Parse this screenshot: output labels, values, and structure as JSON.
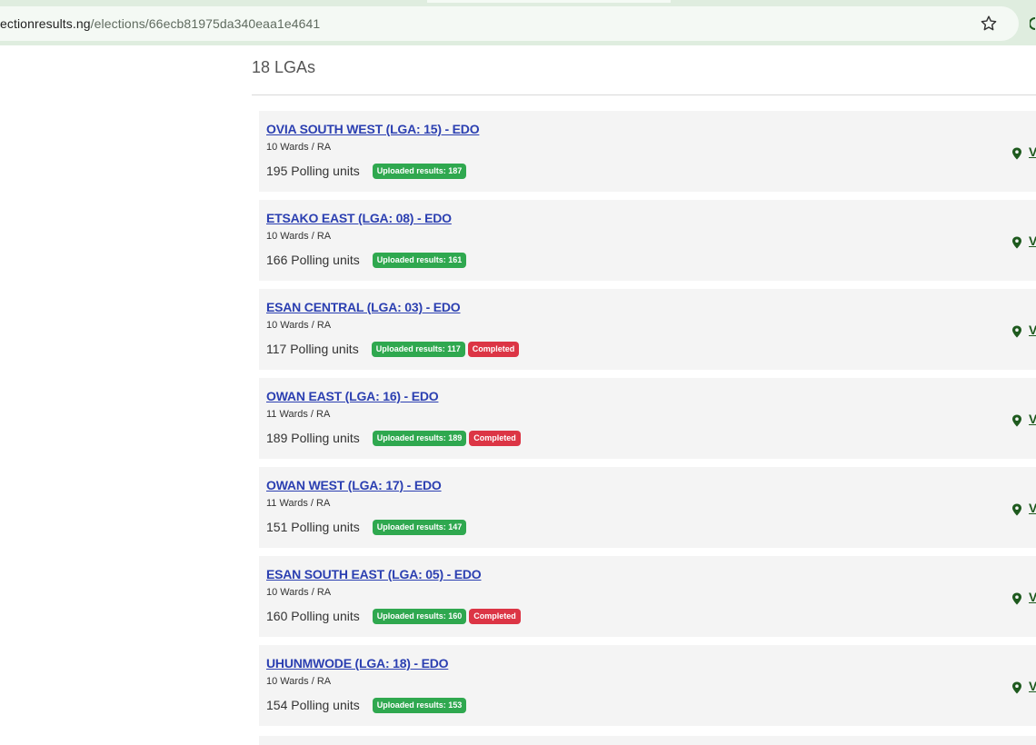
{
  "browser": {
    "url_host": "ectionresults.ng",
    "url_path": "/elections/66ecb81975da340eaa1e4641"
  },
  "page": {
    "title": "18 LGAs"
  },
  "lgas": [
    {
      "name": "OVIA SOUTH WEST (LGA: 15) - EDO",
      "wards": "10 Wards / RA",
      "polling_units": "195 Polling units",
      "uploaded": "Uploaded results: 187",
      "completed": "",
      "view": "V"
    },
    {
      "name": "ETSAKO EAST (LGA: 08) - EDO",
      "wards": "10 Wards / RA",
      "polling_units": "166 Polling units",
      "uploaded": "Uploaded results: 161",
      "completed": "",
      "view": "V"
    },
    {
      "name": "ESAN CENTRAL (LGA: 03) - EDO",
      "wards": "10 Wards / RA",
      "polling_units": "117 Polling units",
      "uploaded": "Uploaded results: 117",
      "completed": "Completed",
      "view": "V"
    },
    {
      "name": "OWAN EAST (LGA: 16) - EDO",
      "wards": "11 Wards / RA",
      "polling_units": "189 Polling units",
      "uploaded": "Uploaded results: 189",
      "completed": "Completed",
      "view": "V"
    },
    {
      "name": "OWAN WEST (LGA: 17) - EDO",
      "wards": "11 Wards / RA",
      "polling_units": "151 Polling units",
      "uploaded": "Uploaded results: 147",
      "completed": "",
      "view": "V"
    },
    {
      "name": "ESAN SOUTH EAST (LGA: 05) - EDO",
      "wards": "10 Wards / RA",
      "polling_units": "160 Polling units",
      "uploaded": "Uploaded results: 160",
      "completed": "Completed",
      "view": "V"
    },
    {
      "name": "UHUNMWODE (LGA: 18) - EDO",
      "wards": "10 Wards / RA",
      "polling_units": "154 Polling units",
      "uploaded": "Uploaded results: 153",
      "completed": "",
      "view": "V"
    }
  ],
  "icons": {
    "star": "star-icon",
    "pin": "map-pin-icon",
    "profile": "profile-icon"
  },
  "colors": {
    "link": "#2b3fb1",
    "uploaded_badge": "#2fa84f",
    "completed_badge": "#dc3545",
    "view_link": "#1e5a1e",
    "chrome": "#dfeddf"
  }
}
